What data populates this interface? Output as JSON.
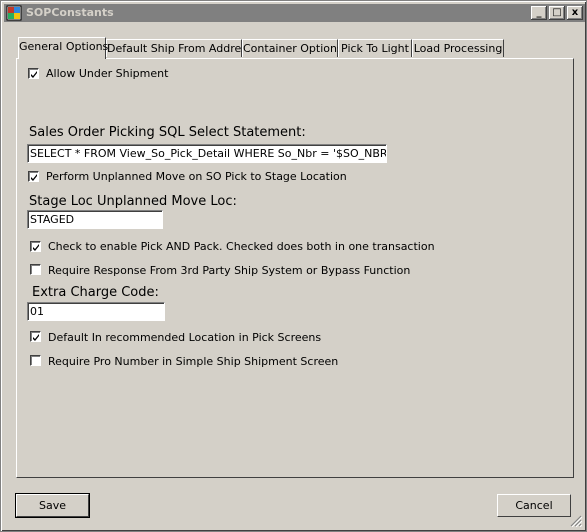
{
  "window": {
    "title": "SOPConstants",
    "controls": {
      "minimize": "_",
      "maximize": "□",
      "close": "x"
    }
  },
  "tabs": [
    {
      "label": "General Options",
      "active": true
    },
    {
      "label": "Default Ship From Address",
      "active": false
    },
    {
      "label": "Container Options",
      "active": false
    },
    {
      "label": "Pick To Light",
      "active": false
    },
    {
      "label": "Load Processing",
      "active": false
    }
  ],
  "general": {
    "allow_under_shipment": {
      "label": "Allow Under Shipment",
      "checked": true
    },
    "sql_label": "Sales Order Picking SQL Select Statement:",
    "sql_value": "SELECT * FROM View_So_Pick_Detail WHERE So_Nbr = '$SO_NBR$' AND",
    "perform_unplanned": {
      "label": "Perform Unplanned Move on SO Pick to Stage Location",
      "checked": true
    },
    "stage_loc_label": "Stage Loc Unplanned Move Loc:",
    "stage_loc_value": "STAGED",
    "pick_and_pack": {
      "label": "Check to enable Pick AND Pack. Checked does both in one transaction",
      "checked": true
    },
    "require_response": {
      "label": "Require Response From 3rd Party Ship System or Bypass Function",
      "checked": false
    },
    "extra_charge_label": "Extra Charge Code:",
    "extra_charge_value": "01",
    "default_in_recommended": {
      "label": "Default In recommended Location in Pick Screens",
      "checked": true
    },
    "require_pro_number": {
      "label": "Require Pro Number in Simple Ship  Shipment Screen",
      "checked": false
    }
  },
  "buttons": {
    "save": "Save",
    "cancel": "Cancel"
  },
  "icons": {
    "app": "app-icon",
    "check": "checkmark-icon",
    "grip": "resize-grip-icon"
  }
}
